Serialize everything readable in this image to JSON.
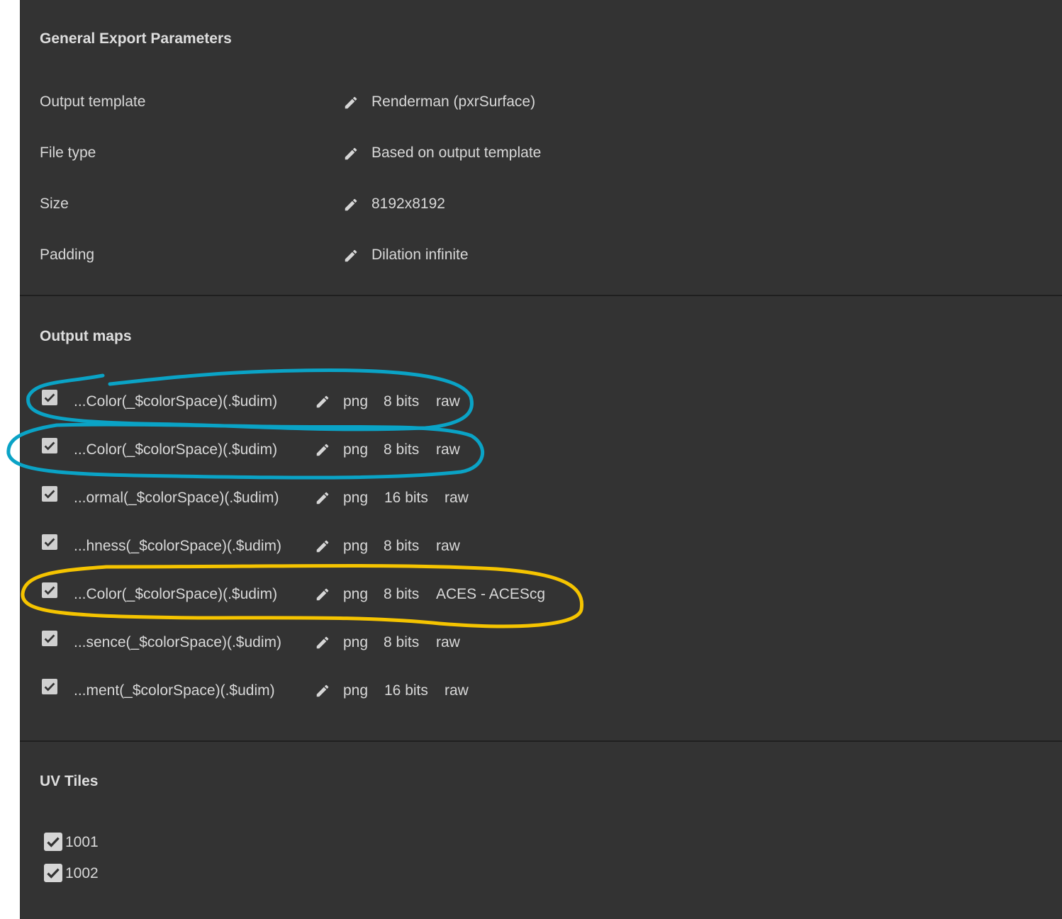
{
  "general": {
    "title": "General Export Parameters",
    "params": [
      {
        "label": "Output template",
        "value": "Renderman (pxrSurface)"
      },
      {
        "label": "File type",
        "value": "Based on output template"
      },
      {
        "label": "Size",
        "value": "8192x8192"
      },
      {
        "label": "Padding",
        "value": "Dilation infinite"
      }
    ]
  },
  "output_maps": {
    "title": "Output maps",
    "rows": [
      {
        "name": "...Color(_$colorSpace)(.$udim)",
        "format": "png",
        "bits": "8 bits",
        "color_space": "raw",
        "checked": true
      },
      {
        "name": "...Color(_$colorSpace)(.$udim)",
        "format": "png",
        "bits": "8 bits",
        "color_space": "raw",
        "checked": true
      },
      {
        "name": "...ormal(_$colorSpace)(.$udim)",
        "format": "png",
        "bits": "16 bits",
        "color_space": "raw",
        "checked": true
      },
      {
        "name": "...hness(_$colorSpace)(.$udim)",
        "format": "png",
        "bits": "8 bits",
        "color_space": "raw",
        "checked": true
      },
      {
        "name": "...Color(_$colorSpace)(.$udim)",
        "format": "png",
        "bits": "8 bits",
        "color_space": "ACES - ACEScg",
        "checked": true
      },
      {
        "name": "...sence(_$colorSpace)(.$udim)",
        "format": "png",
        "bits": "8 bits",
        "color_space": "raw",
        "checked": true
      },
      {
        "name": "...ment(_$colorSpace)(.$udim)",
        "format": "png",
        "bits": "16 bits",
        "color_space": "raw",
        "checked": true
      }
    ]
  },
  "uv_tiles": {
    "title": "UV Tiles",
    "tiles": [
      {
        "label": "1001",
        "checked": true
      },
      {
        "label": "1002",
        "checked": true
      }
    ]
  },
  "annotation_colors": {
    "blue": "#0aa3c6",
    "yellow": "#f5c400"
  }
}
